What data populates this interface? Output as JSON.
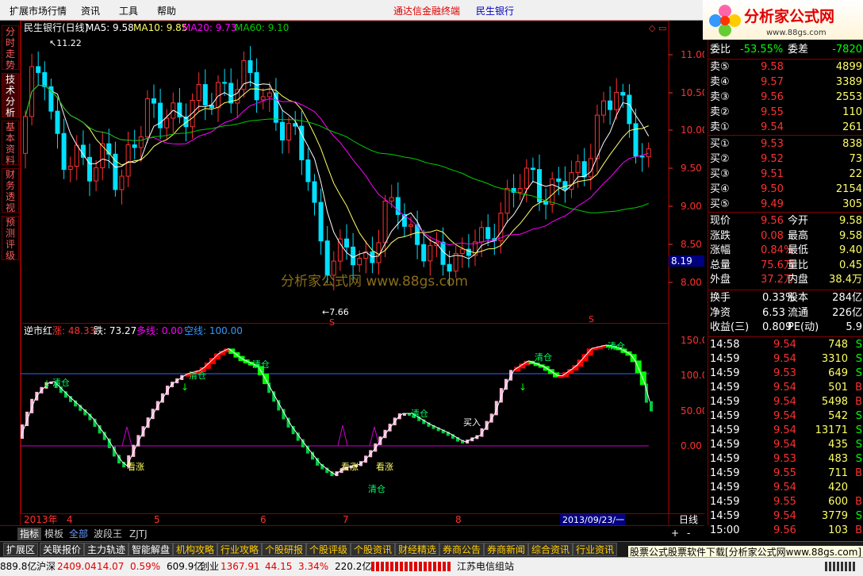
{
  "menu": {
    "items": [
      "扩展市场行情",
      "资讯",
      "工具",
      "帮助"
    ],
    "app_title": "通达信金融终端",
    "stock_title": "民生银行"
  },
  "logo": {
    "text": "分析家公式网",
    "url": "www.88gs.com"
  },
  "left_tabs": [
    "分时走势",
    "技术分析",
    "基本资料",
    "财务透视",
    "预测评级"
  ],
  "main_chart": {
    "header_name": "民生银行(日线)",
    "ma5": "MA5: 9.58",
    "ma10": "MA10: 9.85",
    "ma20": "MA20: 9.73",
    "ma60": "MA60: 9.10",
    "high_marker": "11.22",
    "low_marker": "7.66",
    "current_price_box": "8.19",
    "watermark": "分析家公式网  www.88gs.com",
    "s_marks": [
      "S",
      "S"
    ],
    "y_ticks": [
      "11.00",
      "10.50",
      "10.00",
      "9.50",
      "9.00",
      "8.50",
      "8.00"
    ],
    "colors": {
      "up": "#ff3030",
      "down": "#00e0ff",
      "ma5": "#ffffff",
      "ma10": "#ffff66",
      "ma20": "#ff00ff",
      "ma60": "#00cc00"
    }
  },
  "indicator": {
    "name": "逆市红",
    "up_label": "涨: 48.33",
    "down_label": "跌: 73.27",
    "long_label": "多线: 0.00",
    "short_label": "空线: 100.00",
    "y_ticks": [
      "150.0",
      "100.0",
      "50.00",
      "0.00"
    ],
    "annotations": [
      "看涨",
      "看涨",
      "看涨",
      "清仓",
      "清仓",
      "清仓",
      "清仓",
      "清仓",
      "清仓",
      "清仓",
      "买入"
    ]
  },
  "x_axis": {
    "labels": [
      "2013年",
      "4",
      "5",
      "6",
      "7",
      "8"
    ],
    "date_box": "2013/09/23/一",
    "period": "日线"
  },
  "quote": {
    "wei_bi": {
      "label": "委比",
      "value": "-53.55%",
      "label2": "委差",
      "value2": "-7820"
    },
    "sell": [
      {
        "label": "卖⑤",
        "price": "9.58",
        "vol": "4899"
      },
      {
        "label": "卖④",
        "price": "9.57",
        "vol": "3389"
      },
      {
        "label": "卖③",
        "price": "9.56",
        "vol": "2553"
      },
      {
        "label": "卖②",
        "price": "9.55",
        "vol": "110"
      },
      {
        "label": "卖①",
        "price": "9.54",
        "vol": "261"
      }
    ],
    "buy": [
      {
        "label": "买①",
        "price": "9.53",
        "vol": "838"
      },
      {
        "label": "买②",
        "price": "9.52",
        "vol": "73"
      },
      {
        "label": "买③",
        "price": "9.51",
        "vol": "22"
      },
      {
        "label": "买④",
        "price": "9.50",
        "vol": "2154"
      },
      {
        "label": "买⑤",
        "price": "9.49",
        "vol": "305"
      }
    ],
    "stats": [
      {
        "l1": "现价",
        "v1": "9.56",
        "l2": "今开",
        "v2": "9.58"
      },
      {
        "l1": "涨跌",
        "v1": "0.08",
        "l2": "最高",
        "v2": "9.58"
      },
      {
        "l1": "涨幅",
        "v1": "0.84%",
        "l2": "最低",
        "v2": "9.40"
      },
      {
        "l1": "总量",
        "v1": "75.6万",
        "l2": "量比",
        "v2": "0.45"
      },
      {
        "l1": "外盘",
        "v1": "37.2万",
        "l2": "内盘",
        "v2": "38.4万"
      }
    ],
    "fund": [
      {
        "l1": "换手",
        "v1": "0.33%",
        "l2": "股本",
        "v2": "284亿"
      },
      {
        "l1": "净资",
        "v1": "6.53",
        "l2": "流通",
        "v2": "226亿"
      },
      {
        "l1": "收益(三)",
        "v1": "0.809",
        "l2": "PE(动)",
        "v2": "5.9"
      }
    ],
    "ticks": [
      {
        "time": "14:58",
        "price": "9.54",
        "vol": "748",
        "side": "S"
      },
      {
        "time": "14:59",
        "price": "9.54",
        "vol": "3310",
        "side": "S"
      },
      {
        "time": "14:59",
        "price": "9.53",
        "vol": "649",
        "side": "S"
      },
      {
        "time": "14:59",
        "price": "9.54",
        "vol": "501",
        "side": "B"
      },
      {
        "time": "14:59",
        "price": "9.54",
        "vol": "5498",
        "side": "B"
      },
      {
        "time": "14:59",
        "price": "9.54",
        "vol": "542",
        "side": "S"
      },
      {
        "time": "14:59",
        "price": "9.54",
        "vol": "13171",
        "side": "S"
      },
      {
        "time": "14:59",
        "price": "9.54",
        "vol": "435",
        "side": "S"
      },
      {
        "time": "14:59",
        "price": "9.53",
        "vol": "483",
        "side": "S"
      },
      {
        "time": "14:59",
        "price": "9.55",
        "vol": "711",
        "side": "B"
      },
      {
        "time": "14:59",
        "price": "9.54",
        "vol": "420",
        "side": ""
      },
      {
        "time": "14:59",
        "price": "9.55",
        "vol": "600",
        "side": "B"
      },
      {
        "time": "14:59",
        "price": "9.54",
        "vol": "3779",
        "side": "S"
      },
      {
        "time": "15:00",
        "price": "9.56",
        "vol": "103",
        "side": "B"
      }
    ]
  },
  "bottom_tabs": [
    "指标",
    "模板",
    "全部",
    "波段王",
    "ZJTJ"
  ],
  "menu_tabs": [
    "扩展区",
    "关联报价",
    "主力轨迹",
    "智能解盘",
    "机构攻略",
    "行业攻略",
    "个股研报",
    "个股评级",
    "个股资讯",
    "财经精选",
    "券商公告",
    "券商新闻",
    "综合资讯",
    "行业资讯"
  ],
  "ad_text": "股票公式股票软件下载[分析家公式网www.88gs.com]",
  "status": {
    "amount1": "889.8亿",
    "index2_name": "沪深",
    "index2_val": "2409.04",
    "index2_chg": "14.07",
    "index2_pct": "0.59%",
    "amount2": "609.9亿",
    "index3_name": "创业",
    "index3_val": "1367.91",
    "index3_chg": "44.15",
    "index3_pct": "3.34%",
    "amount3": "220.2亿",
    "station": "江苏电信组站"
  }
}
